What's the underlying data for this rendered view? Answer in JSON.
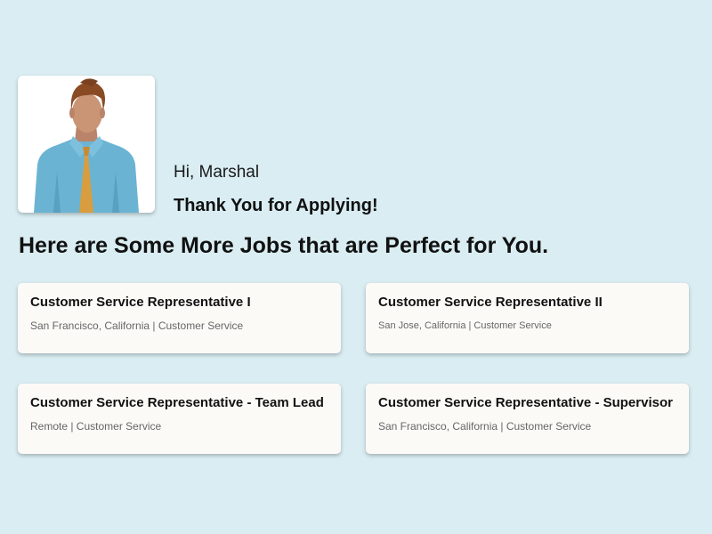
{
  "colors": {
    "background": "#d9edf2",
    "card": "#fcfaf7",
    "shirt": "#6bb3d3",
    "tie": "#d89d3f",
    "hair": "#8a4b24",
    "skin": "#c99575"
  },
  "avatar": {
    "icon": "person-avatar-icon"
  },
  "greeting": "Hi, Marshal",
  "thanks_message": "Thank You for Applying!",
  "headline": "Here are Some More Jobs that are Perfect for You.",
  "jobs": [
    {
      "title": "Customer Service Representative I",
      "meta": "San Francisco, California | Customer Service"
    },
    {
      "title": "Customer Service Representative II",
      "meta": "San Jose, California | Customer Service"
    },
    {
      "title": "Customer Service Representative - Team Lead",
      "meta": "Remote | Customer Service"
    },
    {
      "title": "Customer Service Representative - Supervisor",
      "meta": "San Francisco, California | Customer Service"
    }
  ]
}
